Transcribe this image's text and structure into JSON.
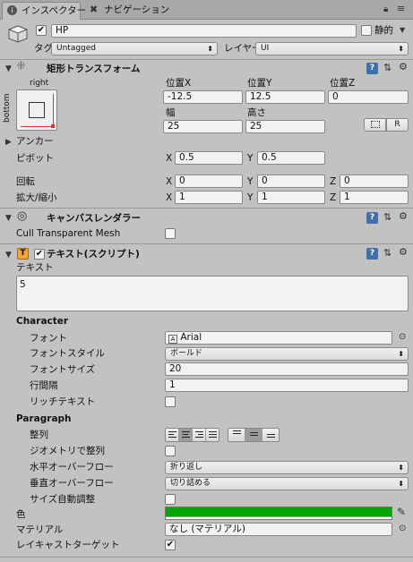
{
  "tabs": [
    {
      "label": "インスペクター",
      "icon": "info-icon",
      "active": true
    },
    {
      "label": "ナビゲーション",
      "icon": "navigation-icon",
      "active": false
    }
  ],
  "object": {
    "name": "HP",
    "static_label": "静的",
    "tag_label": "タグ",
    "tag_value": "Untagged",
    "layer_label": "レイヤー",
    "layer_value": "UI"
  },
  "rect_transform": {
    "title": "矩形トランスフォーム",
    "anchor_preset_top": "right",
    "anchor_preset_side": "bottom",
    "posx_label": "位置X",
    "posy_label": "位置Y",
    "posz_label": "位置Z",
    "posx": "-12.5",
    "posy": "12.5",
    "posz": "0",
    "width_label": "幅",
    "height_label": "高さ",
    "width": "25",
    "height": "25",
    "raw_button": "R",
    "anchors_label": "アンカー",
    "pivot_label": "ピボット",
    "pivot_x": "0.5",
    "pivot_y": "0.5",
    "rotation_label": "回転",
    "rot_x": "0",
    "rot_y": "0",
    "rot_z": "0",
    "scale_label": "拡大/縮小",
    "scale_x": "1",
    "scale_y": "1",
    "scale_z": "1",
    "x": "X",
    "y": "Y",
    "z": "Z"
  },
  "canvas_renderer": {
    "title": "キャンバスレンダラー",
    "cull_label": "Cull Transparent Mesh"
  },
  "text_component": {
    "title": "テキスト(スクリプト)",
    "text_label": "テキスト",
    "text_value": "5",
    "character_header": "Character",
    "font_label": "フォント",
    "font_value": "Arial",
    "font_style_label": "フォントスタイル",
    "font_style_value": "ボールド",
    "font_size_label": "フォントサイズ",
    "font_size_value": "20",
    "line_spacing_label": "行間隔",
    "line_spacing_value": "1",
    "rich_text_label": "リッチテキスト",
    "paragraph_header": "Paragraph",
    "alignment_label": "整列",
    "align_geometry_label": "ジオメトリで整列",
    "h_overflow_label": "水平オーバーフロー",
    "h_overflow_value": "折り返し",
    "v_overflow_label": "垂直オーバーフロー",
    "v_overflow_value": "切り詰める",
    "best_fit_label": "サイズ自動調整",
    "color_label": "色",
    "color_value": "#00a800",
    "material_label": "マテリアル",
    "material_value": "なし (マテリアル)",
    "raycast_label": "レイキャストターゲット"
  }
}
